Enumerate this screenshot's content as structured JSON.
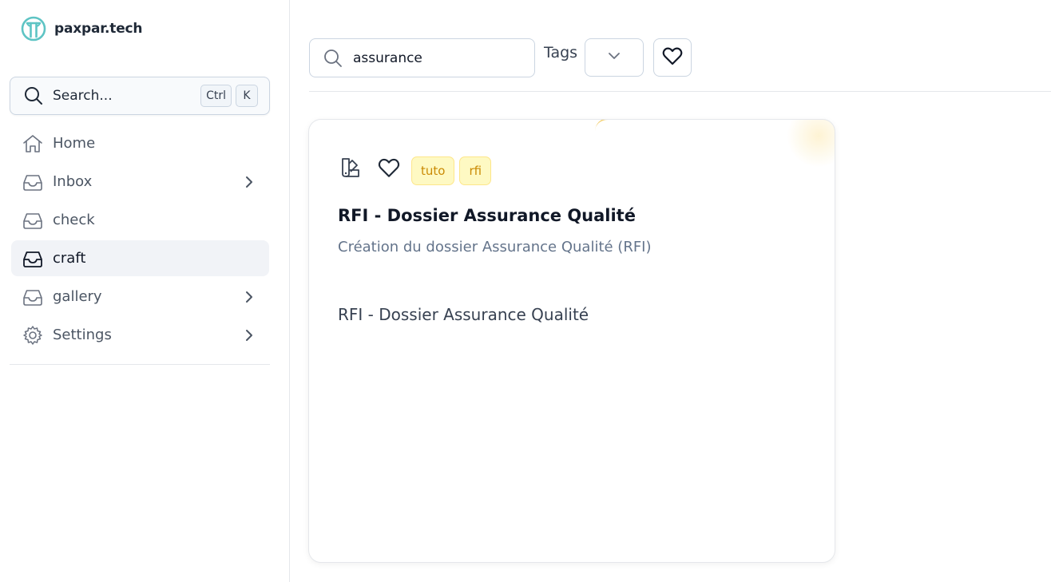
{
  "brand": {
    "name": "paxpar.tech",
    "logo_icon": "paxpar-logo-icon",
    "logo_color": "#5ec4c4"
  },
  "sidebar": {
    "search": {
      "placeholder": "Search...",
      "shortcut_mod": "Ctrl",
      "shortcut_key": "K"
    },
    "items": [
      {
        "label": "Home",
        "icon": "home-icon",
        "has_children": false,
        "active": false
      },
      {
        "label": "Inbox",
        "icon": "inbox-icon",
        "has_children": true,
        "active": false
      },
      {
        "label": "check",
        "icon": "inbox-icon",
        "has_children": false,
        "active": false
      },
      {
        "label": "craft",
        "icon": "inbox-icon",
        "has_children": false,
        "active": true
      },
      {
        "label": "gallery",
        "icon": "inbox-icon",
        "has_children": true,
        "active": false
      },
      {
        "label": "Settings",
        "icon": "gear-icon",
        "has_children": true,
        "active": false
      }
    ]
  },
  "filters": {
    "search_value": "assurance",
    "tags_label": "Tags"
  },
  "card": {
    "tags": [
      "tuto",
      "rfi"
    ],
    "title": "RFI - Dossier Assurance Qualité",
    "subtitle": "Création du dossier Assurance Qualité (RFI)",
    "body": "RFI - Dossier Assurance Qualité",
    "accent_color": "#efc24a"
  }
}
